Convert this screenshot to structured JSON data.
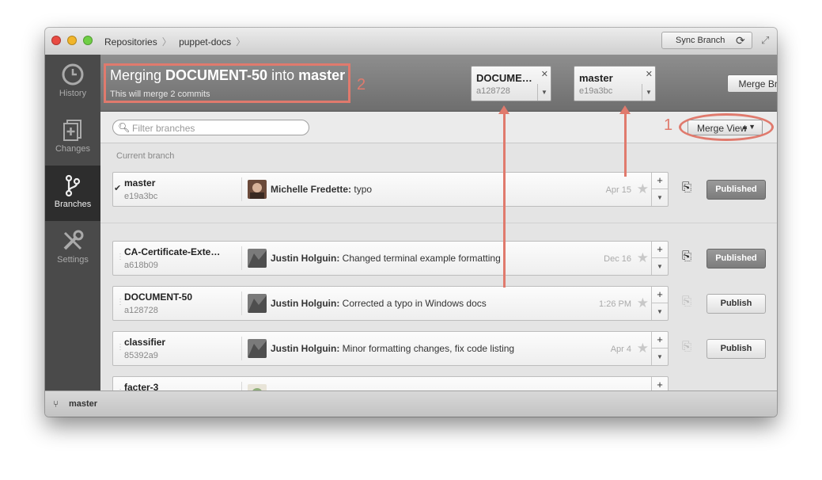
{
  "titlebar": {
    "breadcrumbs": [
      "Repositories",
      "puppet-docs"
    ],
    "sync_label": "Sync Branch"
  },
  "sidebar": {
    "items": [
      {
        "label": "History",
        "icon": "history-icon",
        "active": false
      },
      {
        "label": "Changes",
        "icon": "changes-icon",
        "active": false
      },
      {
        "label": "Branches",
        "icon": "branches-icon",
        "active": true
      },
      {
        "label": "Settings",
        "icon": "settings-icon",
        "active": false
      }
    ]
  },
  "header": {
    "title_prefix": "Merging",
    "title_source": "DOCUMENT-50",
    "title_mid": "into",
    "title_target": "master",
    "subtitle": "This will merge 2 commits",
    "source_branch": {
      "name": "DOCUME…",
      "sha": "a128728"
    },
    "target_branch": {
      "name": "master",
      "sha": "e19a3bc"
    },
    "merge_button": "Merge Branches",
    "annotation_number": "2"
  },
  "filterbar": {
    "placeholder": "Filter branches",
    "merge_view_label": "Merge View",
    "annotation_number": "1"
  },
  "current_branch_label": "Current branch",
  "current_branch": {
    "name": "master",
    "sha": "e19a3bc",
    "author": "Michelle Fredette:",
    "message": "typo",
    "date": "Apr 15",
    "publish_state": "Published"
  },
  "branches": [
    {
      "name": "CA-Certificate-Exte…",
      "sha": "a618b09",
      "author": "Justin Holguin:",
      "message": "Changed terminal example formatting",
      "date": "Dec 16",
      "publish_state": "Published"
    },
    {
      "name": "DOCUMENT-50",
      "sha": "a128728",
      "author": "Justin Holguin:",
      "message": "Corrected a typo in Windows docs",
      "date": "1:26 PM",
      "publish_state": "Publish"
    },
    {
      "name": "classifier",
      "sha": "85392a9",
      "author": "Justin Holguin:",
      "message": "Minor formatting changes, fix code listing",
      "date": "Apr 4",
      "publish_state": "Publish"
    },
    {
      "name": "facter-3",
      "sha": "",
      "author": "",
      "message": "",
      "date": "",
      "publish_state": ""
    }
  ],
  "statusbar": {
    "branch": "master"
  },
  "colors": {
    "annotation": "#e07a6d",
    "sidebar": "#4a4a4a",
    "header": "#7a7a7a"
  }
}
